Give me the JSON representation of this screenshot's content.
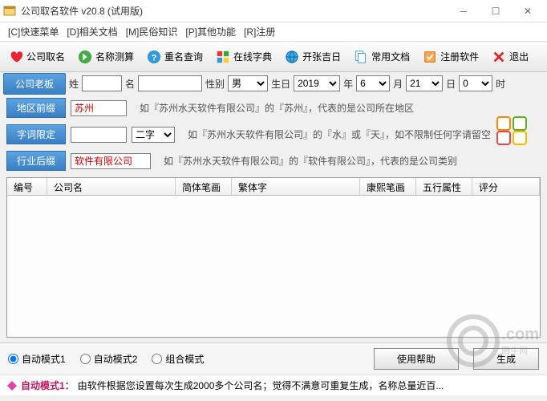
{
  "window": {
    "title": "公司取名软件 v20.8 (试用版)"
  },
  "menu": {
    "c": "[C]快速菜单",
    "d": "[D]相关文档",
    "m": "[M]民俗知识",
    "p": "[P]其他功能",
    "r": "[R]注册"
  },
  "toolbar": {
    "t1": "公司取名",
    "t2": "名称测算",
    "t3": "重名查询",
    "t4": "在线字典",
    "t5": "开张吉日",
    "t6": "常用文档",
    "t7": "注册软件",
    "t8": "退出"
  },
  "tabs": {
    "main": "公司老板"
  },
  "form": {
    "surname_lbl": "姓",
    "given_lbl": "名",
    "gender_lbl": "性别",
    "birth_lbl": "生日",
    "gender_val": "男",
    "year": "2019",
    "year_u": "年",
    "month": "6",
    "month_u": "月",
    "day": "21",
    "day_u": "日",
    "hour": "0",
    "hour_u": "时",
    "region_btn": "地区前缀",
    "region_val": "苏州",
    "region_hint": "如『苏州水天软件有限公司』的『苏州』，代表的是公司所在地区",
    "word_btn": "字词限定",
    "word_sel": "二字",
    "word_hint": "如『苏州水天软件有限公司』的『水』或『天』，如不限制任何字请留空",
    "industry_btn": "行业后缀",
    "industry_val": "软件有限公司",
    "industry_hint": "如『苏州水天软件有限公司』的『软件有限公司』，代表的是公司类别"
  },
  "table": {
    "c1": "编号",
    "c2": "公司名",
    "c3": "简体笔画",
    "c4": "繁体字",
    "c5": "康熙笔画",
    "c6": "五行属性",
    "c7": "评分"
  },
  "modes": {
    "m1": "自动模式1",
    "m2": "自动模式2",
    "m3": "组合模式"
  },
  "actions": {
    "help": "使用帮助",
    "gen": "生成"
  },
  "status": {
    "label": "自动模式1：",
    "text": "由软件根据您设置每次生成2000多个公司名；觉得不满意可重复生成，名称总量近百..."
  },
  "watermark": {
    "text": ".com",
    "sub": "腾牛网"
  }
}
